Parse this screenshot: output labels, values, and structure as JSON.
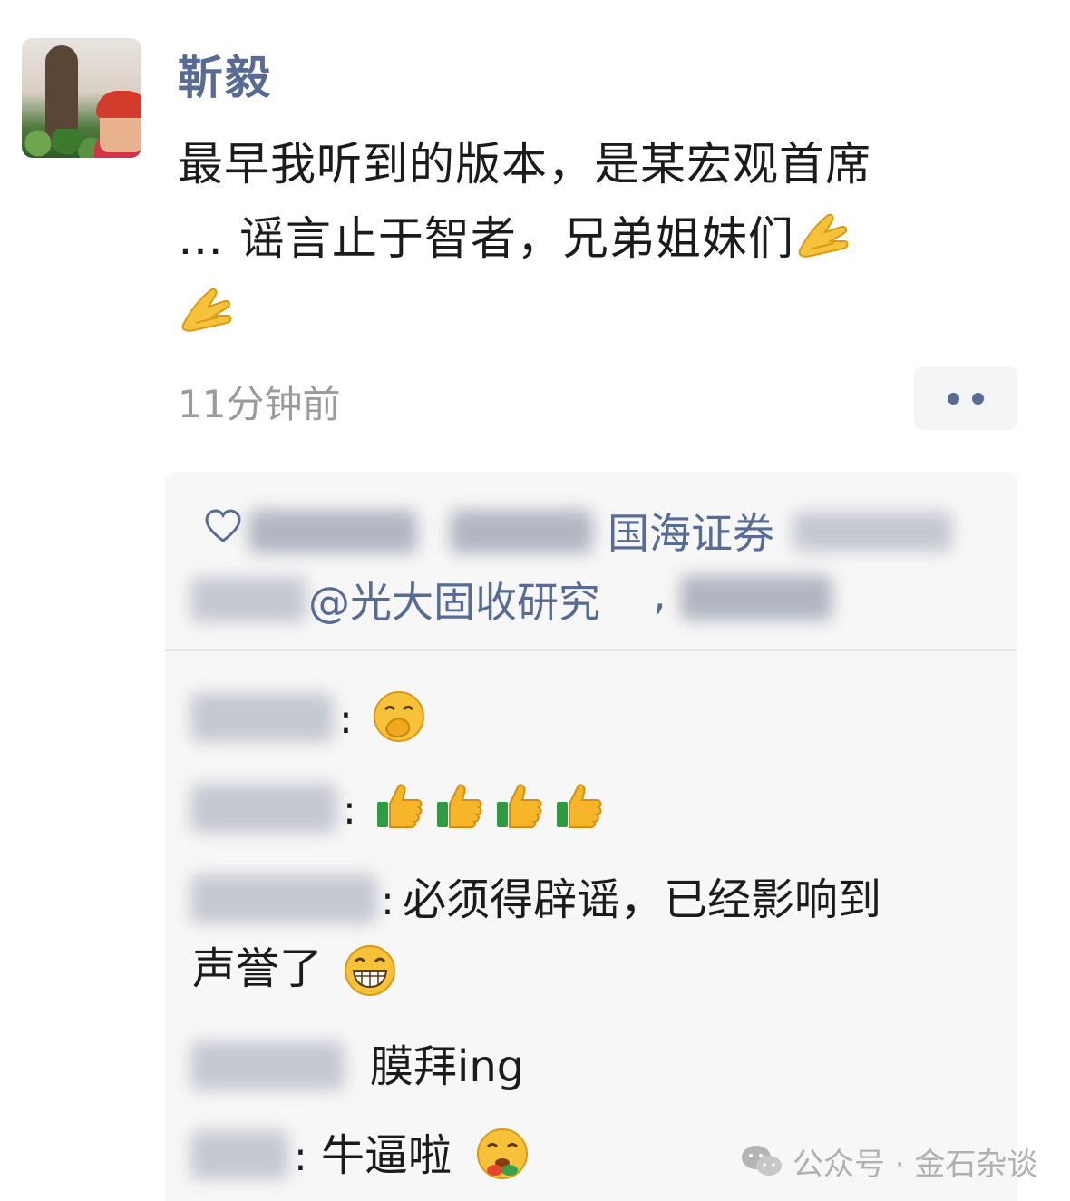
{
  "post": {
    "author": "靳毅",
    "text_line1": "最早我听到的版本，是某宏观首席",
    "text_line2": "… 谣言止于智者，兄弟姐妹们",
    "emojis": [
      "folded-hands",
      "folded-hands"
    ],
    "timestamp": "11分钟前"
  },
  "likes": {
    "visible_segment_1": "国海证券",
    "visible_segment_2": "@光大固收研究",
    "separator": ","
  },
  "comments": [
    {
      "name": "",
      "colon": ":",
      "text": "",
      "emoji": "hand-over-mouth"
    },
    {
      "name": "",
      "colon": ":",
      "text": "",
      "emoji": "thumbs-up x4"
    },
    {
      "name": "",
      "colon": ":",
      "text_line1": "必须得辟谣，已经影响到",
      "text_line2": "声誉了",
      "emoji": "grinning"
    },
    {
      "name": "",
      "colon": "",
      "text": "膜拜ing",
      "emoji": ""
    },
    {
      "name": "",
      "colon": ":",
      "text": "牛逼啦",
      "emoji": "drooling"
    }
  ],
  "watermark": {
    "text": "公众号 · 金石杂谈"
  },
  "colors": {
    "name_blue": "#576b95",
    "timestamp_gray": "#9b9b9b",
    "panel_bg": "#f7f7f7"
  }
}
